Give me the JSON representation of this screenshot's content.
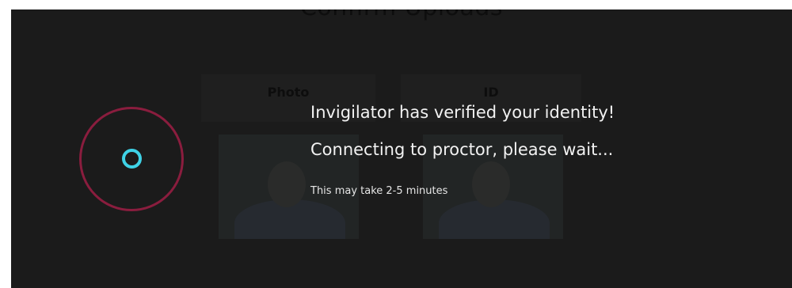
{
  "page": {
    "title": "Confirm Uploads"
  },
  "uploads": {
    "tabs": [
      {
        "label": "Photo"
      },
      {
        "label": "ID"
      }
    ]
  },
  "overlay": {
    "spinner_icon": "loading-spinner-icon",
    "ring_color": "#8a1d3e",
    "dot_color": "#3fd2e6",
    "verified_message": "Invigilator has verified your identity!",
    "connecting_message": "Connecting to proctor, please wait...",
    "duration_note": "This may take 2-5 minutes"
  }
}
